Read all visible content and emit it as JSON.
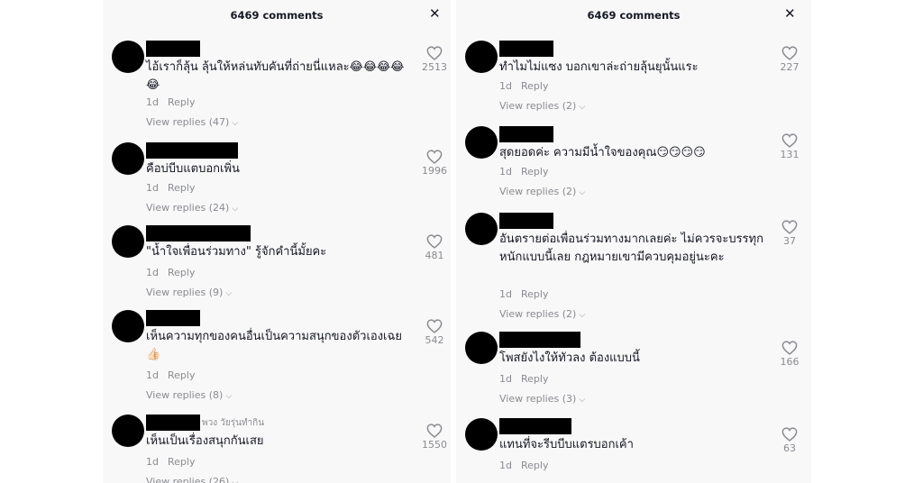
{
  "left": {
    "header": "6469 comments",
    "close": "✕",
    "comments": [
      {
        "username_suffix": "",
        "text": "ไอ้เราก็ลุ้น ลุ้นให้หล่นทับคันที่ถ่ายนี่แหละ😂😂😂😂😂",
        "time": "1d",
        "reply": "Reply",
        "view_replies": "View replies (47)",
        "likes": "2513"
      },
      {
        "username_suffix": "",
        "text": "คือบ่บีบแตบอกเพิ่น",
        "time": "1d",
        "reply": "Reply",
        "view_replies": "View replies (24)",
        "likes": "1996"
      },
      {
        "username_suffix": "",
        "text": "\"น้ำใจเพื่อนร่วมทาง\" รู้จักคำนี้มั้ยคะ",
        "time": "1d",
        "reply": "Reply",
        "view_replies": "View replies (9)",
        "likes": "481"
      },
      {
        "username_suffix": "",
        "text": "เห็นความทุกของคนอื่นเป็นความสนุกของตัวเองเฉย👍🏻",
        "time": "1d",
        "reply": "Reply",
        "view_replies": "View replies (8)",
        "likes": "542"
      },
      {
        "username_suffix": "พวง วัยรุ่นทำกิน",
        "text": "เห็นเป็นเรื่องสนุกกันเสย",
        "time": "1d",
        "reply": "Reply",
        "view_replies": "View replies (26)",
        "likes": "1550"
      }
    ]
  },
  "right": {
    "header": "6469 comments",
    "close": "✕",
    "comments": [
      {
        "text": "ทำไมไม่แซง บอกเขาล่ะถ่ายลุ้นยุนั้นแระ",
        "time": "1d",
        "reply": "Reply",
        "view_replies": "View replies (2)",
        "likes": "227"
      },
      {
        "text": "สุดยอดค่ะ ความมีน้ำใจของคุณ😏😏😏😏",
        "time": "1d",
        "reply": "Reply",
        "view_replies": "View replies (2)",
        "likes": "131"
      },
      {
        "text": "อันตรายต่อเพื่อนร่วมทางมากเลยค่ะ ไม่ควรจะบรรทุกหนักแบบนี้เลย กฎหมายเขามีควบคุมอยู่นะคะ",
        "time": "1d",
        "reply": "Reply",
        "view_replies": "View replies (2)",
        "likes": "37"
      },
      {
        "text": "โพสยังไงให้ทัวลง ต้องแบบนี้",
        "time": "1d",
        "reply": "Reply",
        "view_replies": "View replies (3)",
        "likes": "166"
      },
      {
        "text": "แทนที่จะรีบบีบแตรบอกเค้า",
        "time": "1d",
        "reply": "Reply",
        "view_replies": "",
        "likes": "63"
      }
    ]
  },
  "icons": {
    "heart": "heart-outline-icon",
    "chevron": "chevron-down-icon",
    "close": "close-icon"
  }
}
